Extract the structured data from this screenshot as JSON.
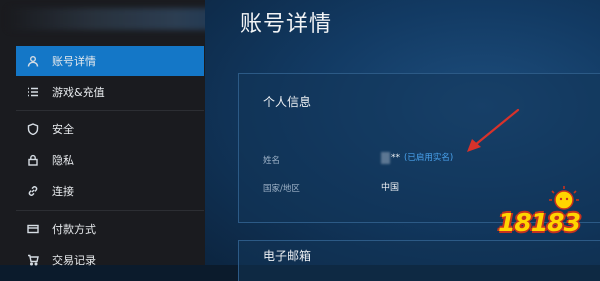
{
  "page": {
    "title": "账号详情"
  },
  "sidebar": {
    "items": [
      {
        "label": "账号详情",
        "icon": "user-icon",
        "active": true
      },
      {
        "label": "游戏&充值",
        "icon": "list-icon",
        "active": false
      },
      {
        "label": "安全",
        "icon": "shield-icon",
        "active": false
      },
      {
        "label": "隐私",
        "icon": "lock-icon",
        "active": false
      },
      {
        "label": "连接",
        "icon": "link-icon",
        "active": false
      },
      {
        "label": "付款方式",
        "icon": "card-icon",
        "active": false
      },
      {
        "label": "交易记录",
        "icon": "cart-icon",
        "active": false
      }
    ]
  },
  "personal_info": {
    "title": "个人信息",
    "name_label": "姓名",
    "name_value": "**",
    "name_status": "(已启用实名)",
    "region_label": "国家/地区",
    "region_value": "中国"
  },
  "email_section": {
    "title": "电子邮箱"
  },
  "watermark": {
    "text": "18183"
  },
  "colors": {
    "accent": "#1477c7",
    "arrow": "#d8322b",
    "verified": "#4aa3ee"
  }
}
